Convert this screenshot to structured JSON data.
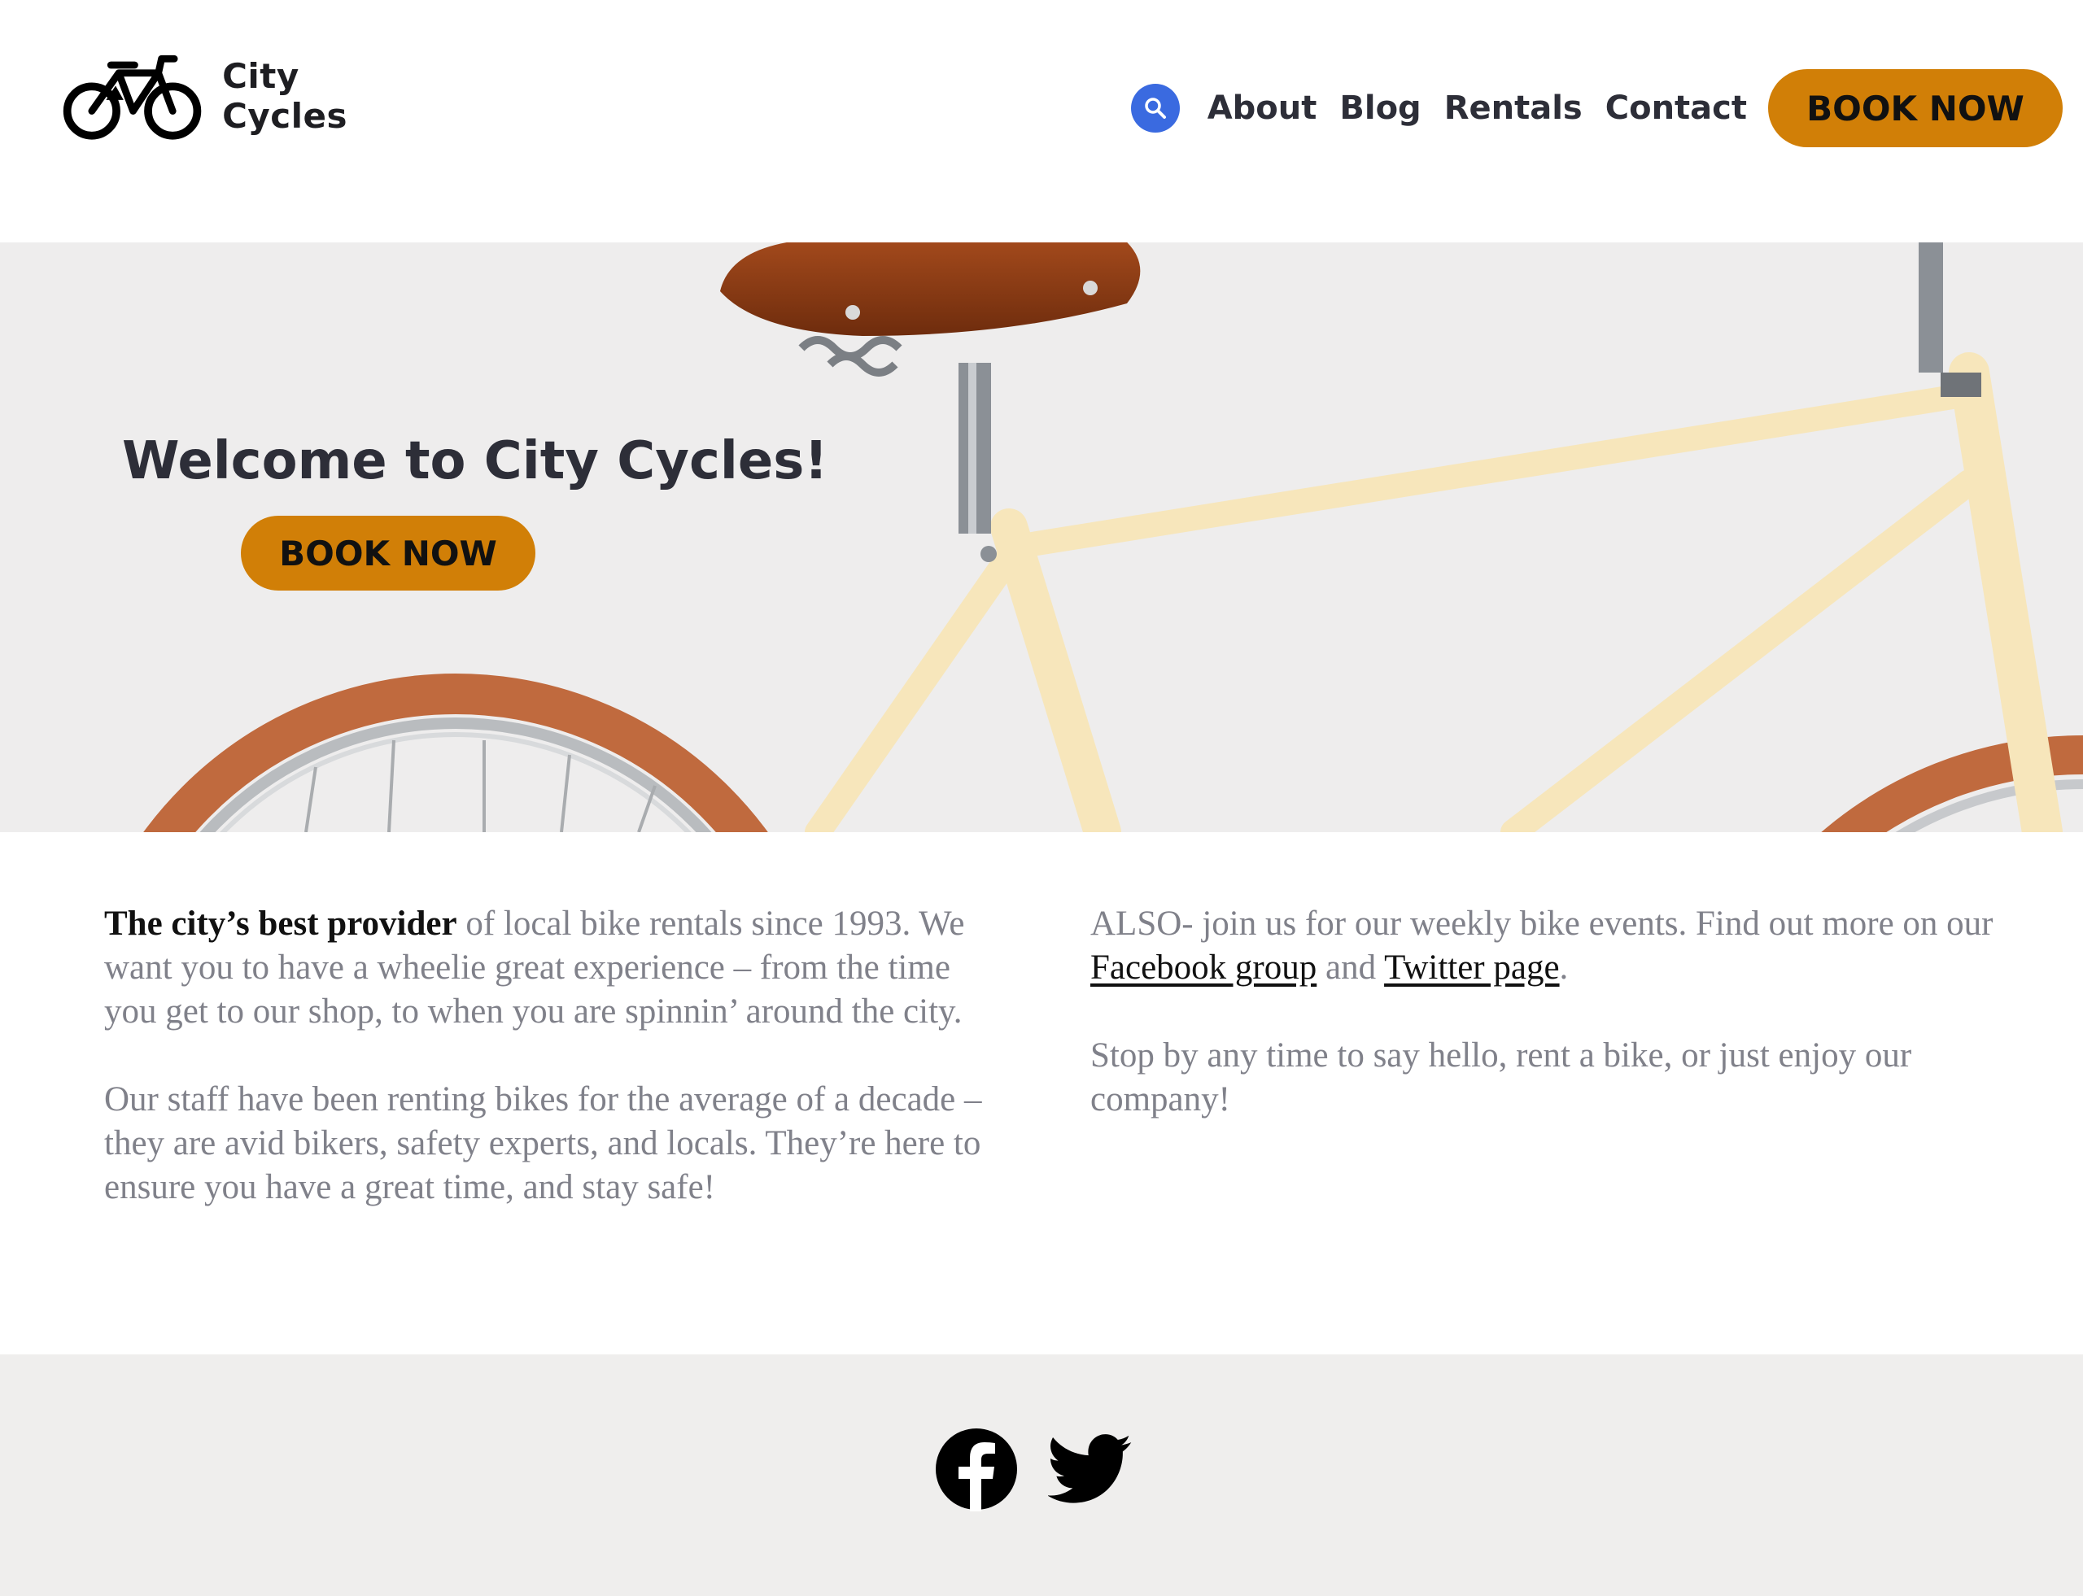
{
  "header": {
    "brand": "City Cycles",
    "nav": [
      "About",
      "Blog",
      "Rentals",
      "Contact"
    ],
    "cta_label": "BOOK NOW",
    "icons": {
      "logo": "bicycle-logo-icon",
      "search": "search-icon"
    }
  },
  "hero": {
    "title": "Welcome to City Cycles!",
    "cta_label": "BOOK NOW",
    "image": "cream-bicycle-photo"
  },
  "content": {
    "left": {
      "p1_strong": "The city’s best provider",
      "p1_rest": " of local bike rentals since 1993. We want you to have a wheelie great experience – from the time you get to our shop, to when you are spinnin’ around the city.",
      "p2": "Our staff have been renting bikes for the average of a decade – they are avid bikers, safety experts, and locals. They’re here to ensure you have a great time, and stay safe!"
    },
    "right": {
      "p1_before": "ALSO- join us for our weekly bike events. Find out more on our ",
      "facebook_link": "Facebook group",
      "p1_middle": " and ",
      "twitter_link": "Twitter page",
      "p1_after": ".",
      "p2": "Stop by any time to say hello, rent a bike, or just enjoy our company!"
    }
  },
  "footer": {
    "icons": [
      "facebook-icon",
      "twitter-icon"
    ]
  },
  "colors": {
    "accent": "#d17f07",
    "search_bg": "#3a6ae0",
    "hero_bg": "#eeeded",
    "footer_bg": "#efeeed",
    "heading_text": "#2d2e38",
    "body_text": "#80818a"
  }
}
